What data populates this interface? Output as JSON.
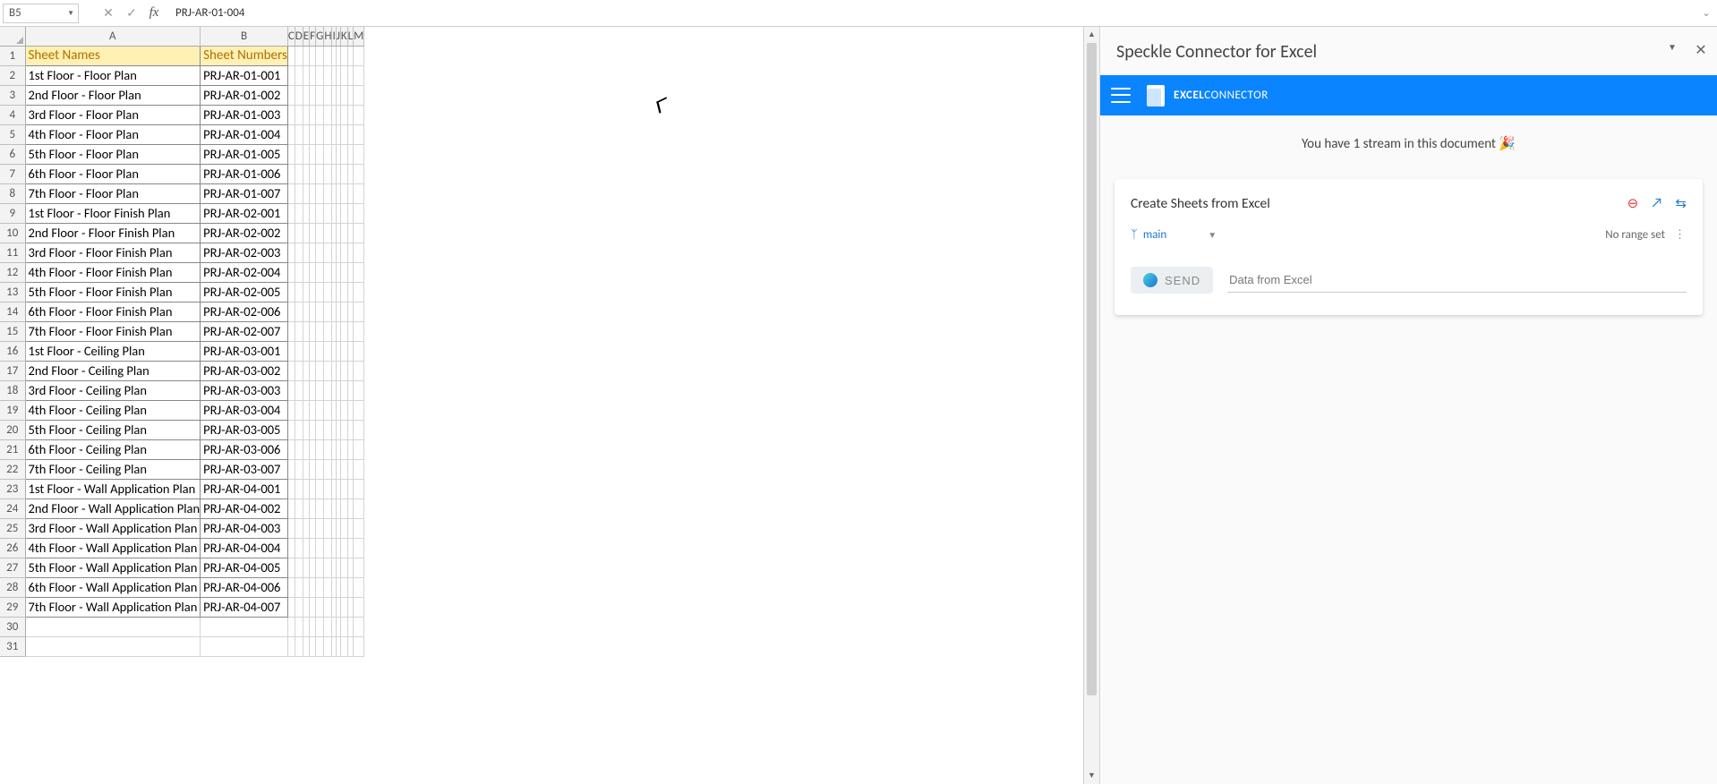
{
  "formula_bar": {
    "name_box": "B5",
    "content": "PRJ-AR-01-004"
  },
  "columns": [
    "A",
    "B",
    "C",
    "D",
    "E",
    "F",
    "G",
    "H",
    "I",
    "J",
    "K",
    "L",
    "M"
  ],
  "headers": {
    "A": "Sheet Names",
    "B": "Sheet Numbers"
  },
  "rows": [
    {
      "n": 2,
      "a": "1st Floor - Floor Plan",
      "b": "PRJ-AR-01-001"
    },
    {
      "n": 3,
      "a": "2nd Floor - Floor Plan",
      "b": "PRJ-AR-01-002"
    },
    {
      "n": 4,
      "a": "3rd Floor - Floor Plan",
      "b": "PRJ-AR-01-003"
    },
    {
      "n": 5,
      "a": "4th Floor - Floor Plan",
      "b": "PRJ-AR-01-004"
    },
    {
      "n": 6,
      "a": "5th Floor - Floor Plan",
      "b": "PRJ-AR-01-005"
    },
    {
      "n": 7,
      "a": "6th Floor - Floor Plan",
      "b": "PRJ-AR-01-006"
    },
    {
      "n": 8,
      "a": "7th Floor - Floor Plan",
      "b": "PRJ-AR-01-007"
    },
    {
      "n": 9,
      "a": "1st Floor - Floor Finish Plan",
      "b": "PRJ-AR-02-001"
    },
    {
      "n": 10,
      "a": "2nd Floor - Floor Finish Plan",
      "b": "PRJ-AR-02-002"
    },
    {
      "n": 11,
      "a": "3rd Floor - Floor Finish Plan",
      "b": "PRJ-AR-02-003"
    },
    {
      "n": 12,
      "a": "4th Floor - Floor Finish Plan",
      "b": "PRJ-AR-02-004"
    },
    {
      "n": 13,
      "a": "5th Floor - Floor Finish Plan",
      "b": "PRJ-AR-02-005"
    },
    {
      "n": 14,
      "a": "6th Floor - Floor Finish Plan",
      "b": "PRJ-AR-02-006"
    },
    {
      "n": 15,
      "a": "7th Floor - Floor Finish Plan",
      "b": "PRJ-AR-02-007"
    },
    {
      "n": 16,
      "a": "1st Floor - Ceiling Plan",
      "b": "PRJ-AR-03-001"
    },
    {
      "n": 17,
      "a": "2nd Floor - Ceiling Plan",
      "b": "PRJ-AR-03-002"
    },
    {
      "n": 18,
      "a": "3rd Floor - Ceiling Plan",
      "b": "PRJ-AR-03-003"
    },
    {
      "n": 19,
      "a": "4th Floor - Ceiling Plan",
      "b": "PRJ-AR-03-004"
    },
    {
      "n": 20,
      "a": "5th Floor - Ceiling Plan",
      "b": "PRJ-AR-03-005"
    },
    {
      "n": 21,
      "a": "6th Floor - Ceiling Plan",
      "b": "PRJ-AR-03-006"
    },
    {
      "n": 22,
      "a": "7th Floor - Ceiling Plan",
      "b": "PRJ-AR-03-007"
    },
    {
      "n": 23,
      "a": "1st Floor - Wall Application Plan",
      "b": "PRJ-AR-04-001"
    },
    {
      "n": 24,
      "a": "2nd Floor - Wall Application Plan",
      "b": "PRJ-AR-04-002"
    },
    {
      "n": 25,
      "a": "3rd Floor - Wall Application Plan",
      "b": "PRJ-AR-04-003"
    },
    {
      "n": 26,
      "a": "4th Floor - Wall Application Plan",
      "b": "PRJ-AR-04-004"
    },
    {
      "n": 27,
      "a": "5th Floor - Wall Application Plan",
      "b": "PRJ-AR-04-005"
    },
    {
      "n": 28,
      "a": "6th Floor - Wall Application Plan",
      "b": "PRJ-AR-04-006"
    },
    {
      "n": 29,
      "a": "7th Floor - Wall Application Plan",
      "b": "PRJ-AR-04-007"
    }
  ],
  "blank_rows": [
    30,
    31
  ],
  "panel": {
    "title": "Speckle Connector for Excel",
    "brand_bold": "EXCEL",
    "brand_light": "CONNECTOR",
    "stream_msg": "You have 1 stream in this document 🎉",
    "card_title": "Create Sheets from Excel",
    "branch": "main",
    "range": "No range set",
    "send": "SEND",
    "data_label": "Data from Excel"
  }
}
